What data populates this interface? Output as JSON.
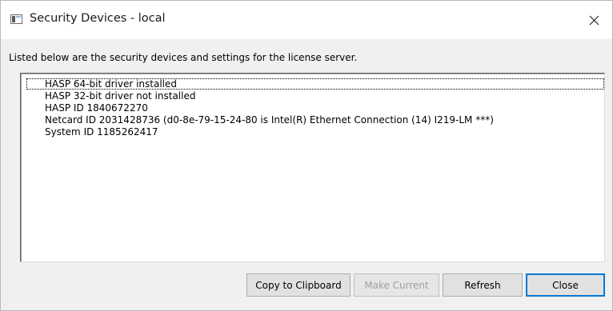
{
  "window": {
    "title": "Security Devices - local"
  },
  "description": "Listed below are the security devices and settings for the license server.",
  "devices": [
    "HASP 64-bit driver installed",
    "HASP 32-bit driver not installed",
    "HASP ID 1840672270",
    "Netcard ID 2031428736 (d0-8e-79-15-24-80 is Intel(R) Ethernet Connection (14) I219-LM ***)",
    "System ID 1185262417"
  ],
  "buttons": {
    "copy": "Copy to Clipboard",
    "make_current": "Make Current",
    "refresh": "Refresh",
    "close": "Close"
  },
  "icons": {
    "app": "window-app-icon",
    "close": "close-icon"
  },
  "colors": {
    "accent": "#0078d7",
    "disabled_text": "#a0a0a0"
  }
}
